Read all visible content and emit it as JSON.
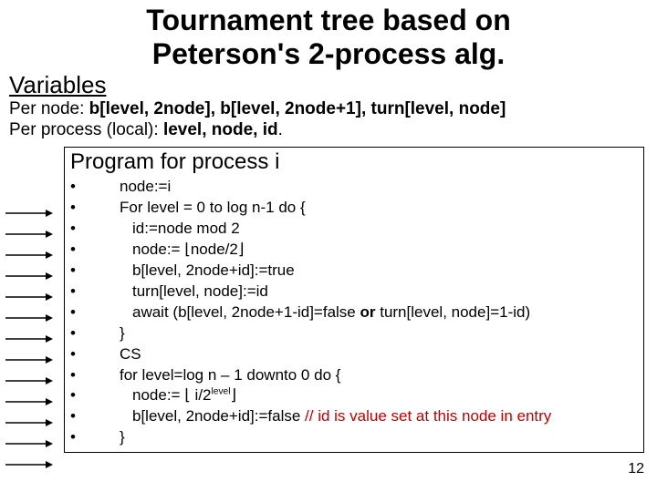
{
  "title_line1": "Tournament tree based on",
  "title_line2": "Peterson's 2-process alg.",
  "variables_heading": "Variables",
  "vars_line1_prefix": "Per node: ",
  "vars_line1_bold": "b[level, 2node], b[level, 2node+1], turn[level, node]",
  "vars_line2_prefix": "Per process (local): ",
  "vars_line2_bold": "level, node, id",
  "program_heading": "Program for process i",
  "code": [
    {
      "indent": 2,
      "text": "node:=i"
    },
    {
      "indent": 2,
      "text": "For level = 0 to log n-1 do {"
    },
    {
      "indent": 3,
      "text": "id:=node mod 2"
    },
    {
      "indent": 3,
      "text": "node:= ⌊node/2⌋"
    },
    {
      "indent": 3,
      "text": "b[level, 2node+id]:=true"
    },
    {
      "indent": 3,
      "text": "turn[level, node]:=id"
    },
    {
      "indent": 3,
      "text_parts": [
        {
          "t": "await (b[level, 2node+1-id]=false "
        },
        {
          "t": "or",
          "bold": true
        },
        {
          "t": " turn[level, node]=1-id)"
        }
      ]
    },
    {
      "indent": 2,
      "text": "}"
    },
    {
      "indent": 2,
      "text": "CS"
    },
    {
      "indent": 2,
      "text": "for level=log n – 1 downto 0 do {"
    },
    {
      "indent": 3,
      "text_html": "node:= ⌊ i/2<span class=\"sup\">level</span>⌋"
    },
    {
      "indent": 3,
      "text_parts": [
        {
          "t": "b[level, 2node+id]:=false "
        },
        {
          "t": "// id is value set at this node in entry",
          "comment": true
        }
      ]
    },
    {
      "indent": 2,
      "text": "}"
    }
  ],
  "page_number": "12",
  "arrow_count": 13
}
